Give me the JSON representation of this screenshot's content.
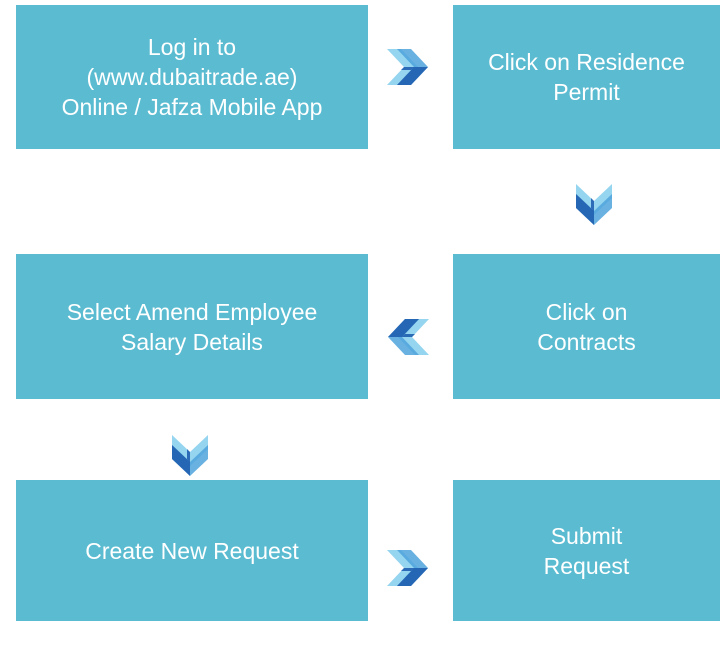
{
  "steps": [
    {
      "label": "Log in to\n(www.dubaitrade.ae)\nOnline / Jafza Mobile App"
    },
    {
      "label": "Click on Residence\nPermit"
    },
    {
      "label": "Click on\nContracts"
    },
    {
      "label": "Select Amend Employee\nSalary Details"
    },
    {
      "label": "Create New Request"
    },
    {
      "label": "Submit\nRequest"
    }
  ],
  "arrows": [
    {
      "direction": "right",
      "icon": "chevron-right-arrow-icon"
    },
    {
      "direction": "down",
      "icon": "chevron-down-arrow-icon"
    },
    {
      "direction": "left",
      "icon": "chevron-left-arrow-icon"
    },
    {
      "direction": "down",
      "icon": "chevron-down-arrow-icon"
    },
    {
      "direction": "right",
      "icon": "chevron-right-arrow-icon"
    }
  ],
  "colors": {
    "box": "#5bbcd1",
    "text": "#ffffff",
    "arrow_light": "#8fd3ee",
    "arrow_mid": "#4fa3dc",
    "arrow_dark": "#1f5fb0"
  }
}
